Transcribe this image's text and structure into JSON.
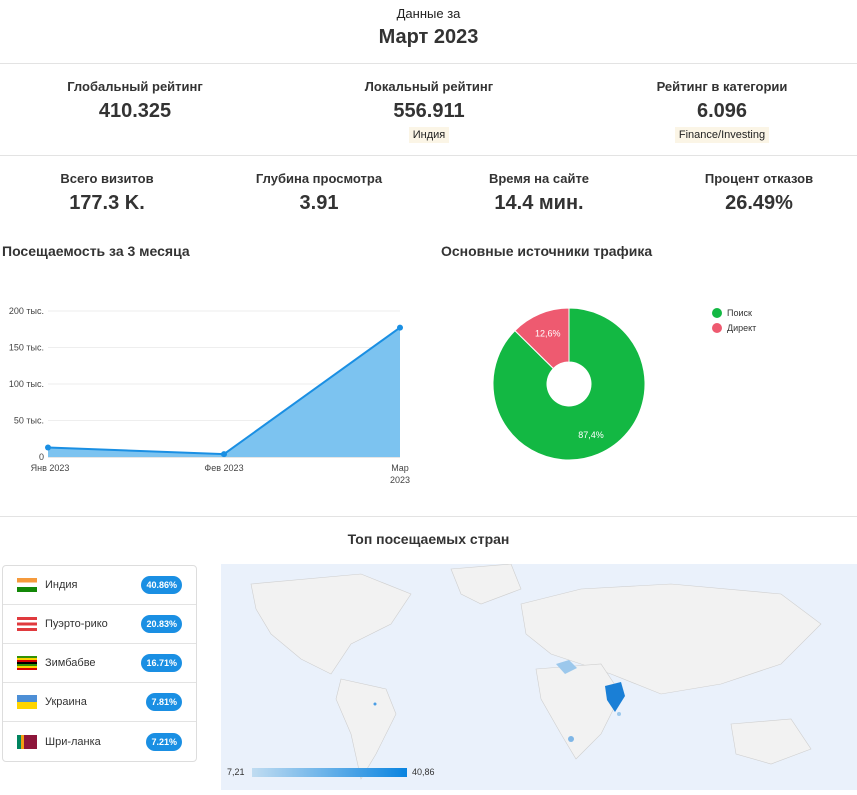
{
  "header": {
    "subtitle": "Данные за",
    "title": "Март 2023"
  },
  "ranks": [
    {
      "label": "Глобальный рейтинг",
      "value": "410.325"
    },
    {
      "label": "Локальный рейтинг",
      "value": "556.911",
      "badge": "Индия"
    },
    {
      "label": "Рейтинг в категории",
      "value": "6.096",
      "badge": "Finance/Investing"
    }
  ],
  "metrics": [
    {
      "label": "Всего визитов",
      "value": "177.3 K."
    },
    {
      "label": "Глубина просмотра",
      "value": "3.91"
    },
    {
      "label": "Время на сайте",
      "value": "14.4 мин."
    },
    {
      "label": "Процент отказов",
      "value": "26.49%"
    }
  ],
  "traffic_title": "Посещаемость за 3 месяца",
  "sources_title": "Основные источники трафика",
  "countries_title": "Топ посещаемых стран",
  "chart_data": [
    {
      "type": "area",
      "title": "Посещаемость за 3 месяца",
      "categories": [
        "Янв 2023",
        "Фев 2023",
        "Мар 2023"
      ],
      "x_labels": [
        [
          "Янв 2023"
        ],
        [
          "Фев 2023"
        ],
        [
          "Мар",
          "2023"
        ]
      ],
      "values": [
        13000,
        4000,
        177300
      ],
      "ylim": [
        0,
        200000
      ],
      "yticks": [
        {
          "v": 0,
          "label": "0"
        },
        {
          "v": 50000,
          "label": "50 тыс."
        },
        {
          "v": 100000,
          "label": "100 тыс."
        },
        {
          "v": 150000,
          "label": "150 тыс."
        },
        {
          "v": 200000,
          "label": "200 тыс."
        }
      ],
      "color": "#1a8fe3"
    },
    {
      "type": "pie",
      "title": "Основные источники трафика",
      "slices": [
        {
          "name": "Поиск",
          "value": 87.4,
          "label": "87,4%",
          "color": "#13b843"
        },
        {
          "name": "Директ",
          "value": 12.6,
          "label": "12,6%",
          "color": "#ee5a70"
        }
      ],
      "legend": "right"
    }
  ],
  "countries": [
    {
      "name": "Индия",
      "pct": "40.86%",
      "flag": "india"
    },
    {
      "name": "Пуэрто-рико",
      "pct": "20.83%",
      "flag": "pr"
    },
    {
      "name": "Зимбабве",
      "pct": "16.71%",
      "flag": "zw"
    },
    {
      "name": "Украина",
      "pct": "7.81%",
      "flag": "ua"
    },
    {
      "name": "Шри-ланка",
      "pct": "7.21%",
      "flag": "lk"
    }
  ],
  "map_legend": {
    "min": "7,21",
    "max": "40,86"
  }
}
